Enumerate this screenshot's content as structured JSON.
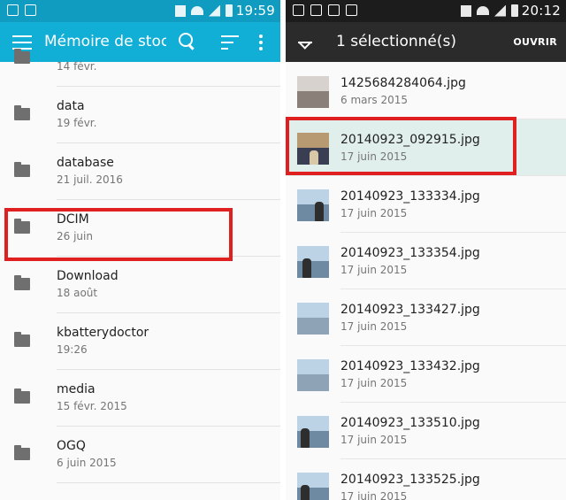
{
  "left": {
    "status": {
      "time": "19:59"
    },
    "toolbar": {
      "title": "Mémoire de stockage"
    },
    "items": [
      {
        "name": "",
        "date": "14 févr."
      },
      {
        "name": "data",
        "date": "19 févr."
      },
      {
        "name": "database",
        "date": "21 juil. 2016"
      },
      {
        "name": "DCIM",
        "date": "26 juin"
      },
      {
        "name": "Download",
        "date": "18 août"
      },
      {
        "name": "kbatterydoctor",
        "date": "19:26"
      },
      {
        "name": "media",
        "date": "15 févr. 2015"
      },
      {
        "name": "OGQ",
        "date": "6 juin 2015"
      }
    ]
  },
  "right": {
    "status": {
      "time": "20:12"
    },
    "toolbar": {
      "title": "1 sélectionné(s)",
      "open_label": "OUVRIR"
    },
    "files": [
      {
        "name": "1425684284064.jpg",
        "date": "6 mars 2015",
        "selected": false
      },
      {
        "name": "20140923_092915.jpg",
        "date": "17 juin 2015",
        "selected": true
      },
      {
        "name": "20140923_133334.jpg",
        "date": "17 juin 2015",
        "selected": false
      },
      {
        "name": "20140923_133354.jpg",
        "date": "17 juin 2015",
        "selected": false
      },
      {
        "name": "20140923_133427.jpg",
        "date": "17 juin 2015",
        "selected": false
      },
      {
        "name": "20140923_133432.jpg",
        "date": "17 juin 2015",
        "selected": false
      },
      {
        "name": "20140923_133510.jpg",
        "date": "17 juin 2015",
        "selected": false
      },
      {
        "name": "20140923_133525.jpg",
        "date": "17 juin 2015",
        "selected": false
      }
    ]
  },
  "colors": {
    "primary": "#11aed6",
    "primary_dark": "#0f9cc0",
    "action_bar_dark": "#2b2b2b",
    "selection": "#e1efec",
    "highlight": "#e02020"
  }
}
